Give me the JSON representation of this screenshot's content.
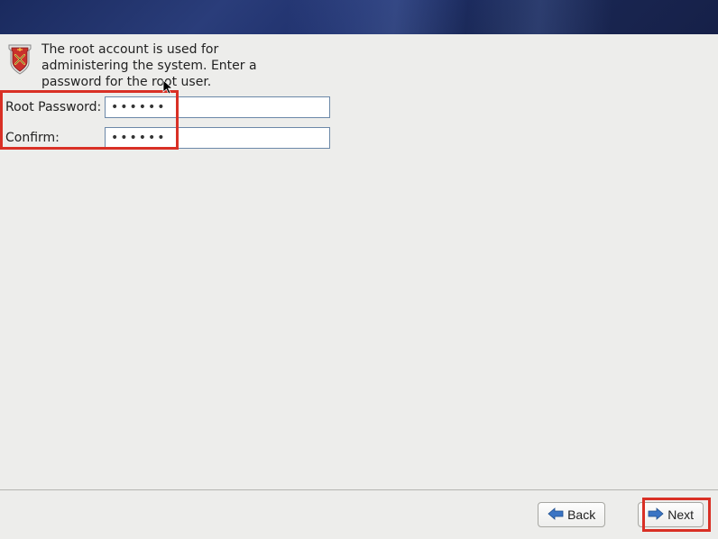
{
  "description": "The root account is used for administering the system.  Enter a password for the root user.",
  "form": {
    "password_label": "Root Password:",
    "password_value": "••••••",
    "confirm_label": "Confirm:",
    "confirm_value": "••••••"
  },
  "footer": {
    "back_label": "Back",
    "next_label": "Next"
  }
}
